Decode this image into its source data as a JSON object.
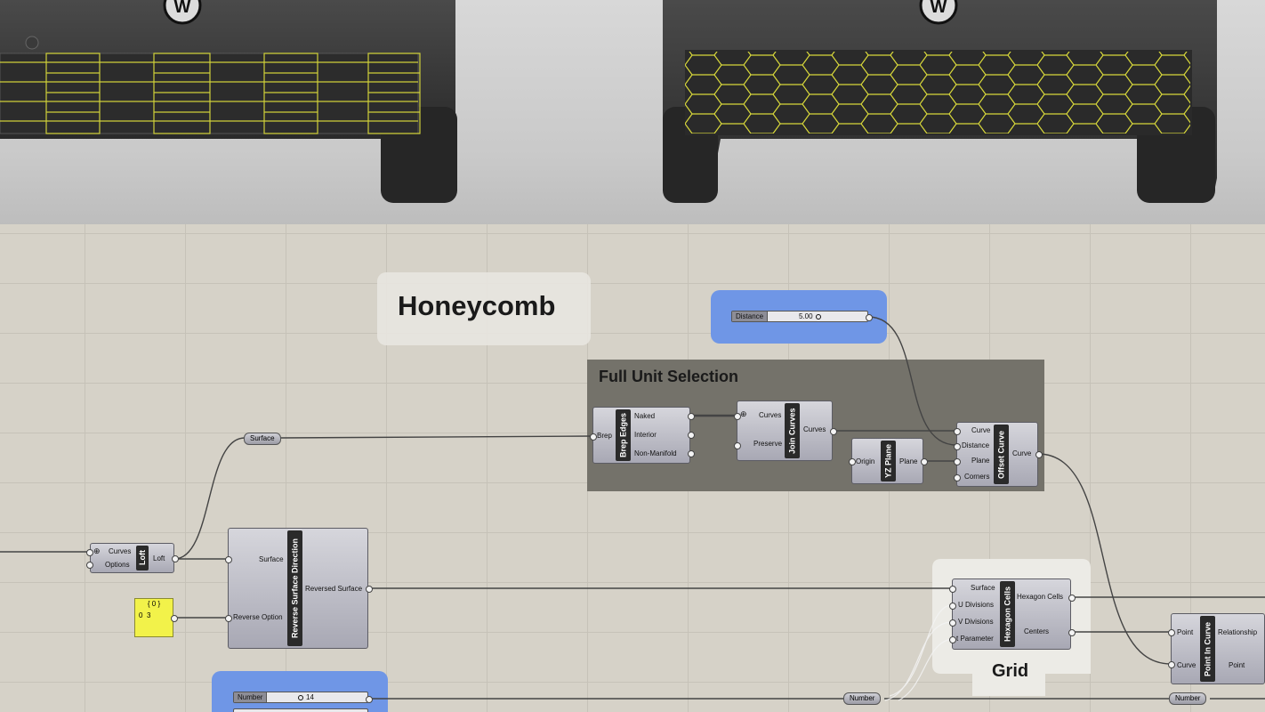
{
  "viewport": {
    "left_view": "car-front-quad-grid",
    "right_view": "car-front-honeycomb"
  },
  "groups": {
    "honeycomb_title": "Honeycomb",
    "full_unit_selection_title": "Full Unit Selection",
    "grid_title": "Grid"
  },
  "sliders": {
    "distance": {
      "label": "Distance",
      "value": "5.00"
    },
    "number": {
      "label": "Number",
      "value": "14"
    }
  },
  "relays": {
    "surface": "Surface",
    "number_mid": "Number",
    "number_right": "Number"
  },
  "panel": {
    "header": "{ 0 }",
    "index": "0",
    "value": "3"
  },
  "nodes": {
    "loft": {
      "name": "Loft",
      "inputs": [
        "Curves",
        "Options"
      ],
      "outputs": [
        "Loft"
      ]
    },
    "reverse": {
      "name": "Reverse Surface Direction",
      "inputs": [
        "Surface",
        "Reverse Option"
      ],
      "outputs": [
        "Reversed Surface"
      ]
    },
    "brep_edges": {
      "name": "Brep Edges",
      "inputs": [
        "Brep"
      ],
      "outputs": [
        "Naked",
        "Interior",
        "Non-Manifold"
      ]
    },
    "join_curves": {
      "name": "Join Curves",
      "inputs": [
        "Curves",
        "Preserve"
      ],
      "outputs": [
        "Curves"
      ]
    },
    "yz_plane": {
      "name": "YZ Plane",
      "inputs": [
        "Origin"
      ],
      "outputs": [
        "Plane"
      ]
    },
    "offset_curve": {
      "name": "Offset Curve",
      "inputs": [
        "Curve",
        "Distance",
        "Plane",
        "Corners"
      ],
      "outputs": [
        "Curve"
      ]
    },
    "hexagon_cells": {
      "name": "Hexagon Cells",
      "inputs": [
        "Surface",
        "U Divisions",
        "V Divisions",
        "t Parameter"
      ],
      "outputs": [
        "Hexagon Cells",
        "Centers"
      ]
    },
    "point_in_curve": {
      "name": "Point In Curve",
      "inputs": [
        "Point",
        "Curve"
      ],
      "outputs": [
        "Relationship",
        "Point"
      ]
    }
  },
  "colors": {
    "canvas": "#d6d2c8",
    "group_blue": "#6f96e6",
    "group_dark": "#74726a",
    "panel_yellow": "#f2f24a",
    "node": "#b4b4be"
  }
}
